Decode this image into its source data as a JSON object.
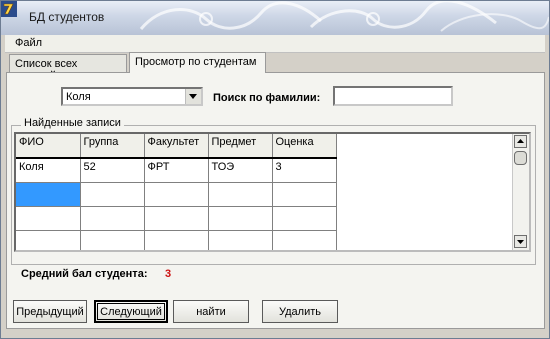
{
  "window": {
    "title": "БД студентов"
  },
  "menu": {
    "file": "Файл"
  },
  "tabs": [
    {
      "label": "Список всех записей",
      "active": false
    },
    {
      "label": "Просмотр по студентам",
      "active": true
    }
  ],
  "filter": {
    "student_combo_value": "Коля",
    "search_label": "Поиск по фамилии:",
    "search_value": ""
  },
  "records": {
    "group_title": "Найденные записи",
    "columns": [
      "ФИО",
      "Группа",
      "Факультет",
      "Предмет",
      "Оценка"
    ],
    "rows": [
      [
        "Коля",
        "52",
        "ФРТ",
        "ТОЭ",
        "3"
      ],
      [
        "",
        "",
        "",
        "",
        ""
      ],
      [
        "",
        "",
        "",
        "",
        ""
      ],
      [
        "",
        "",
        "",
        "",
        ""
      ]
    ]
  },
  "summary": {
    "avg_label": "Средний бал студента:",
    "avg_value": "3"
  },
  "buttons": {
    "prev": "Предыдущий",
    "next": "Следующий",
    "find": "найти",
    "delete": "Удалить"
  },
  "colors": {
    "selection": "#3399ff",
    "avg_value": "#cc1111",
    "titlebar": "#cdd6e6"
  }
}
